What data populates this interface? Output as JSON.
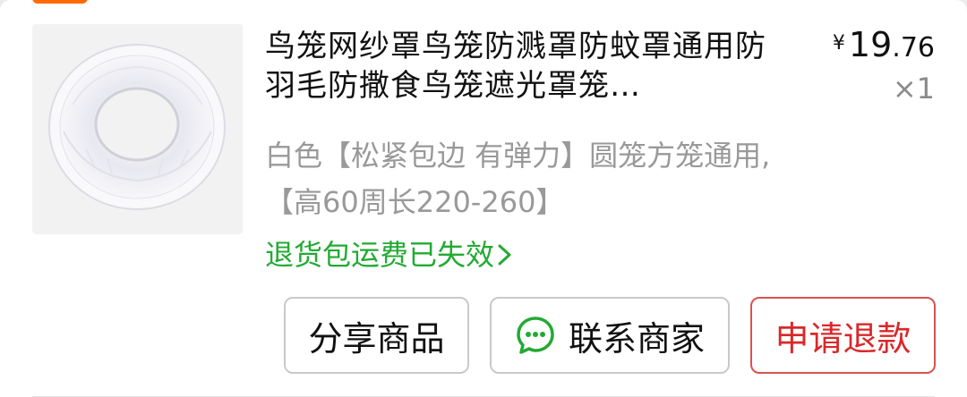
{
  "product": {
    "title": "鸟笼网纱罩鸟笼防溅罩防蚊罩通用防羽毛防撒食鸟笼遮光罩笼…",
    "price_currency": "¥",
    "price_integer": "19",
    "price_decimal": ".76",
    "quantity": "×1",
    "spec": "白色【松紧包边 有弹力】圆笼方笼通用,【高60周长220-260】",
    "return_notice": "退货包运费已失效"
  },
  "actions": {
    "share_label": "分享商品",
    "contact_label": "联系商家",
    "refund_label": "申请退款"
  },
  "colors": {
    "accent_green": "#22aa33",
    "refund_red": "#d9282a",
    "tag_orange": "#ff6a00"
  },
  "icons": {
    "thumbnail": "mesh-cover-image",
    "chevron": "chevron-right-icon",
    "chat": "chat-bubble-icon"
  }
}
